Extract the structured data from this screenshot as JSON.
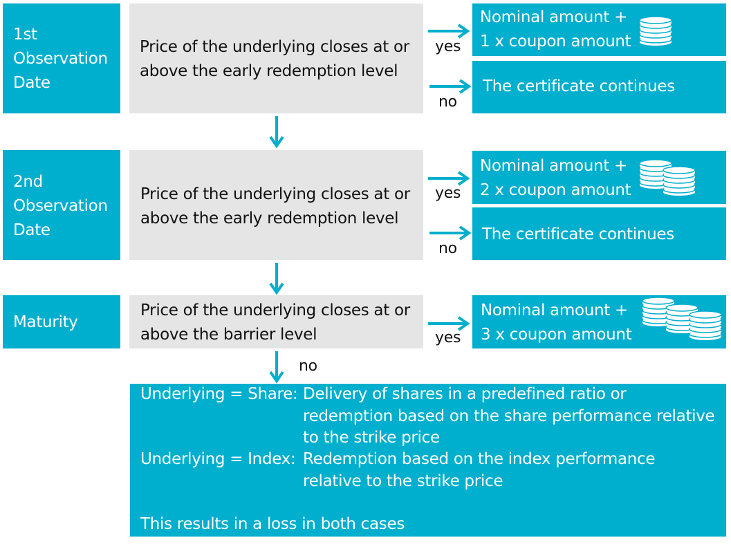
{
  "colors": {
    "accent": "#00aecd",
    "condition_bg": "#e5e5e5"
  },
  "rows": [
    {
      "date": "1st Observation Date",
      "condition": "Price of the underlying closes at or above the early redemption level",
      "yes_label": "yes",
      "no_label": "no",
      "yes_result": [
        "Nominal amount +",
        "1 x coupon amount"
      ],
      "no_result": "The certificate continues",
      "coin_stacks": 1
    },
    {
      "date": "2nd Observation Date",
      "condition": "Price of the underlying closes at or above the early redemption level",
      "yes_label": "yes",
      "no_label": "no",
      "yes_result": [
        "Nominal amount +",
        "2 x coupon amount"
      ],
      "no_result": "The certificate continues",
      "coin_stacks": 2
    },
    {
      "date": "Maturity",
      "condition": "Price of the underlying closes at or above the barrier level",
      "yes_label": "yes",
      "no_label": "no",
      "yes_result": [
        "Nominal amount +",
        "3 x coupon amount"
      ],
      "coin_stacks": 3
    }
  ],
  "final": {
    "share_label": "Underlying = Share:",
    "share_text": "Delivery of shares in a predefined ratio or redemption based on the share performance relative to the strike price",
    "index_label": "Underlying = Index:",
    "index_text": "Redemption based on the index performance relative to the strike price",
    "conclusion": "This results in a loss in both cases"
  }
}
